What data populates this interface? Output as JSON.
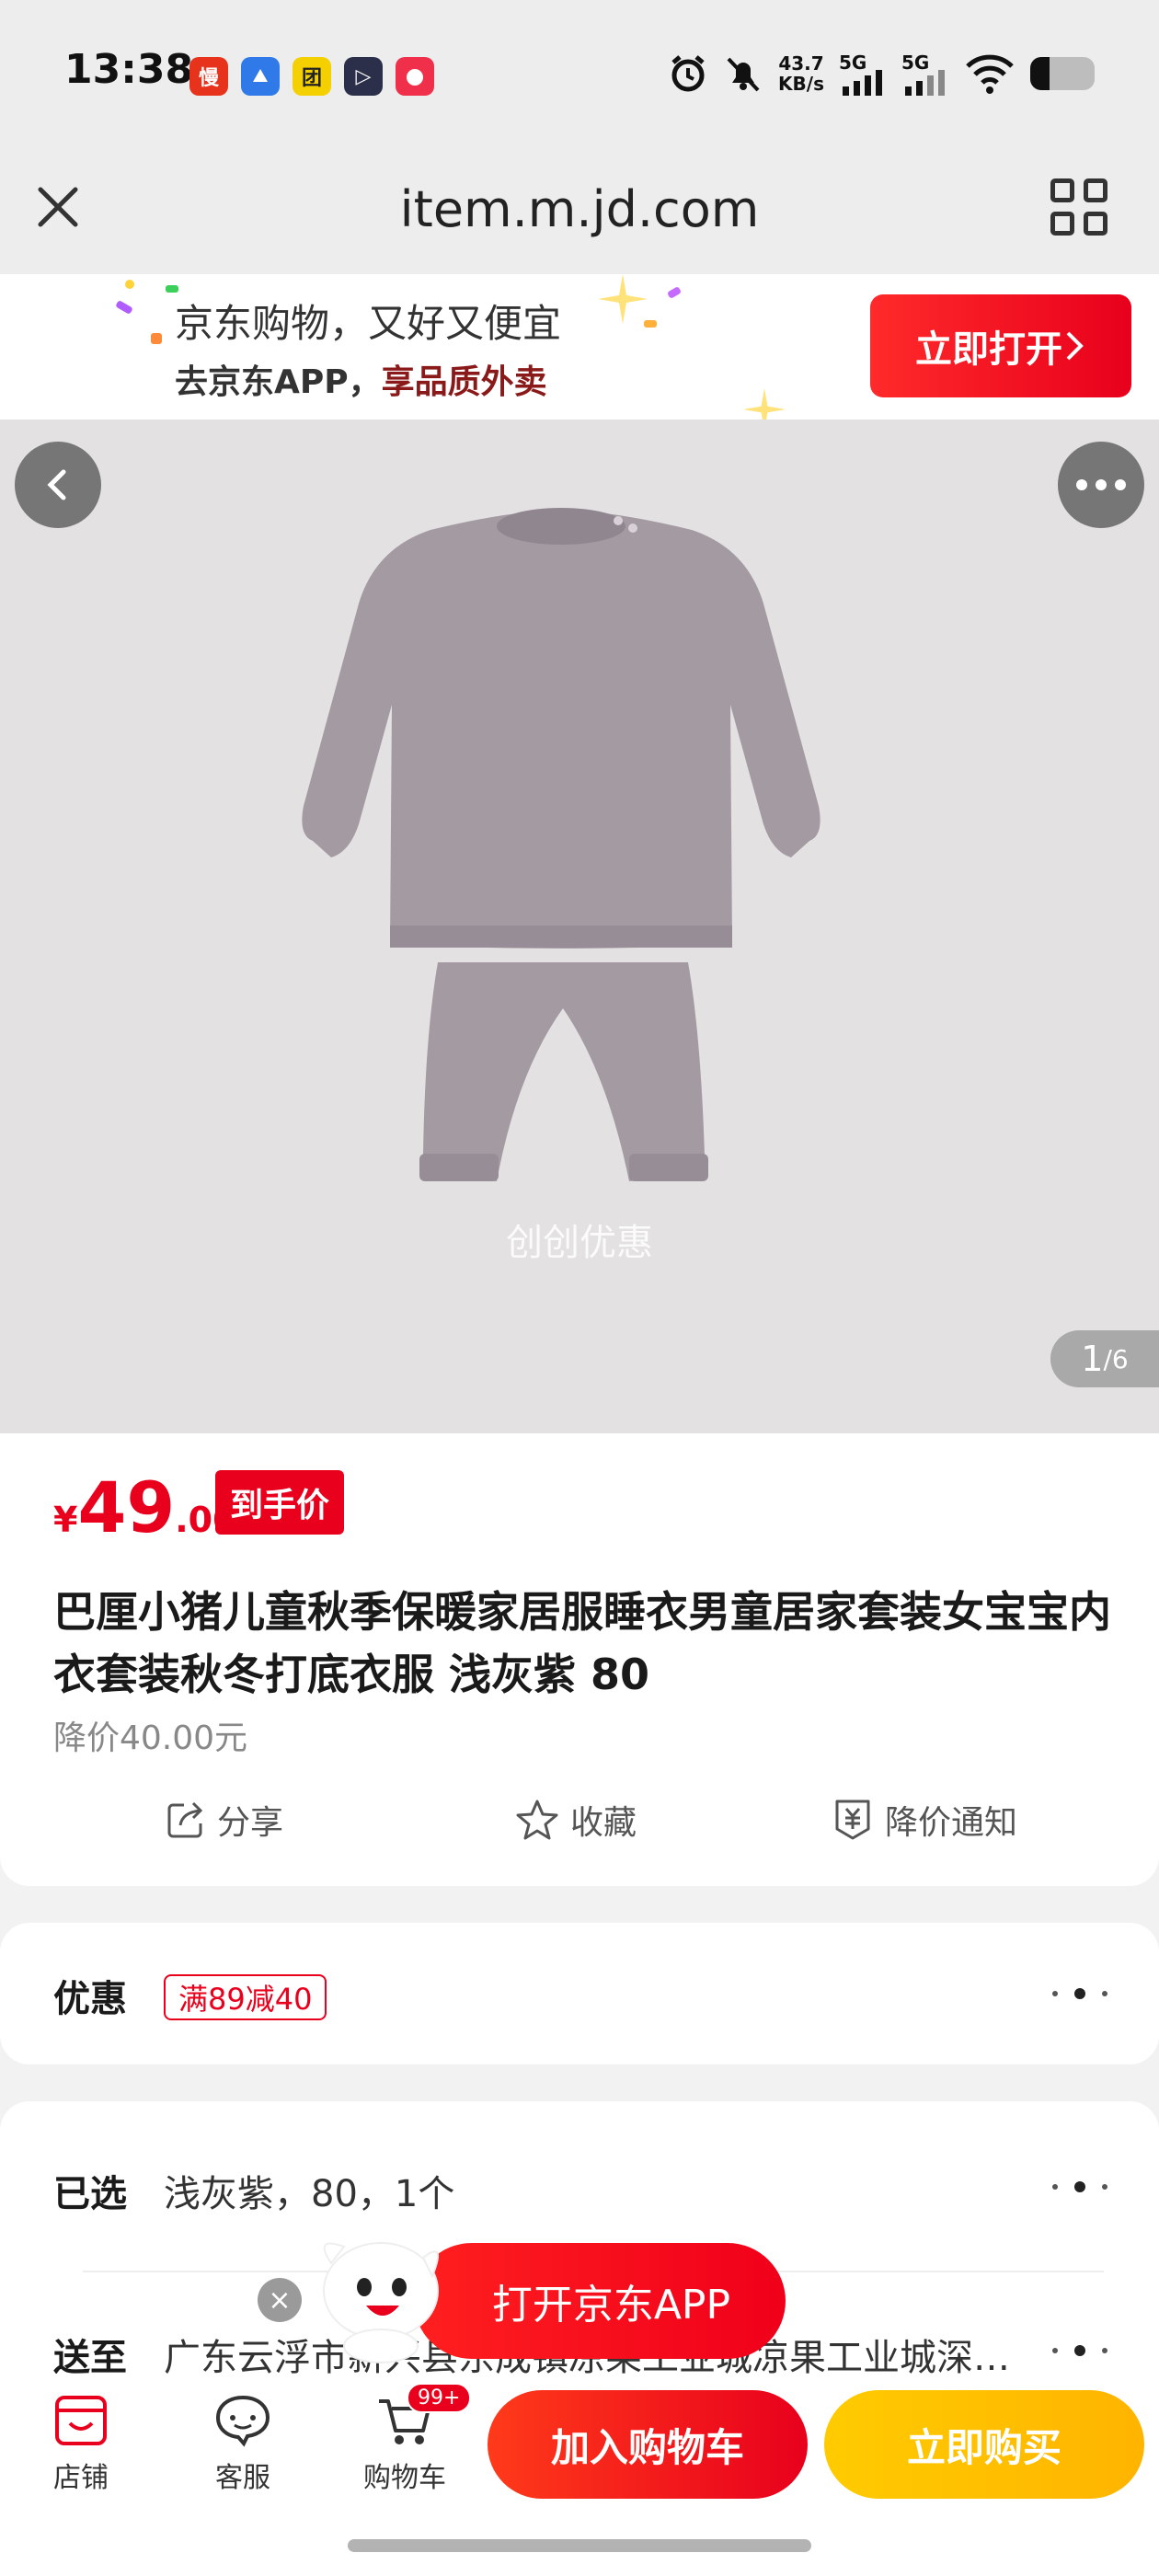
{
  "status_bar": {
    "time": "13:38",
    "app_icons": [
      "慢",
      "",
      "团",
      "▷",
      ""
    ],
    "speed_value": "43.7",
    "speed_unit": "KB/s",
    "network1": "5G",
    "network2": "5G",
    "battery_level": 0.3
  },
  "browser": {
    "url": "item.m.jd.com",
    "icons": [
      "close-icon",
      "grid-icon"
    ]
  },
  "banner": {
    "line1": "京东购物，又好又便宜",
    "line2_prefix": "去京东APP，",
    "line2_highlight": "享品质外卖",
    "open_button": "立即打开"
  },
  "gallery": {
    "watermark": "创创优惠",
    "current": "1",
    "total": "/6"
  },
  "product": {
    "currency": "¥",
    "price_int": "49",
    "price_dec": ".00",
    "price_tag": "到手价",
    "title": "巴厘小猪儿童秋季保暖家居服睡衣男童居家套装女宝宝内衣套装秋冬打底衣服 浅灰紫 80",
    "price_drop": "降价40.00元",
    "actions": {
      "share": "分享",
      "favorite": "收藏",
      "price_alert": "降价通知"
    },
    "primary_color": "#e8001c"
  },
  "promo": {
    "label": "优惠",
    "coupon": "满89减40"
  },
  "selection": {
    "selected_label": "已选",
    "selected_value": "浅灰紫，80，1个",
    "ship_label": "送至",
    "ship_value": "广东云浮市新兴县东成镇凉果工业城凉果工业城深…"
  },
  "floating": {
    "open_app": "打开京东APP",
    "close": "×"
  },
  "bottom_bar": {
    "store": "店铺",
    "service": "客服",
    "cart": "购物车",
    "cart_badge": "99+",
    "add_to_cart": "加入购物车",
    "buy_now": "立即购买"
  }
}
